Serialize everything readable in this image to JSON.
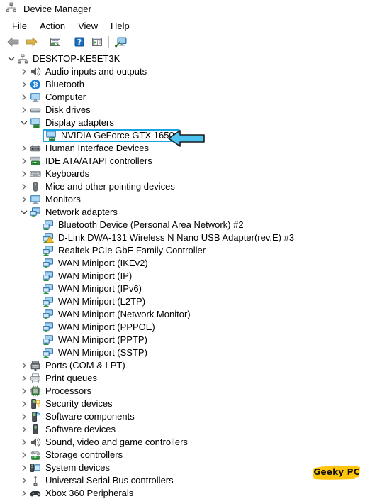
{
  "window": {
    "title": "Device Manager",
    "icon": "device-manager-icon"
  },
  "menubar": {
    "items": [
      {
        "label": "File"
      },
      {
        "label": "Action"
      },
      {
        "label": "View"
      },
      {
        "label": "Help"
      }
    ]
  },
  "toolbar": {
    "buttons": [
      {
        "name": "back-button",
        "icon": "back-arrow-icon"
      },
      {
        "name": "forward-button",
        "icon": "forward-arrow-icon"
      },
      {
        "name": "properties-button",
        "icon": "properties-icon"
      },
      {
        "name": "help-button",
        "icon": "help-question-icon"
      },
      {
        "name": "update-driver-button",
        "icon": "update-driver-icon"
      },
      {
        "name": "scan-hardware-button",
        "icon": "scan-hardware-icon"
      }
    ]
  },
  "annotation": {
    "arrow": {
      "direction": "left",
      "color": "#4cc3ef",
      "outline": "#1a1a1a"
    },
    "highlight_color": "#18a5e0",
    "highlighted_item": "NVIDIA GeForce GTX 1650"
  },
  "watermark": {
    "text": "Geeky PC",
    "bg_color": "#ffc40c"
  },
  "tree": {
    "nodes": [
      {
        "label": "DESKTOP-KE5ET3K",
        "level": 0,
        "state": "expanded",
        "icon": "computer-node-icon",
        "name": "tree-item-desktop-ke5et3k"
      },
      {
        "label": "Audio inputs and outputs",
        "level": 1,
        "state": "collapsed",
        "icon": "speaker-icon",
        "name": "tree-item-audio-inputs-and-outputs"
      },
      {
        "label": "Bluetooth",
        "level": 1,
        "state": "collapsed",
        "icon": "bluetooth-icon",
        "name": "tree-item-bluetooth"
      },
      {
        "label": "Computer",
        "level": 1,
        "state": "collapsed",
        "icon": "monitor-icon",
        "name": "tree-item-computer"
      },
      {
        "label": "Disk drives",
        "level": 1,
        "state": "collapsed",
        "icon": "disk-drive-icon",
        "name": "tree-item-disk-drives"
      },
      {
        "label": "Display adapters",
        "level": 1,
        "state": "expanded",
        "icon": "display-adapter-icon",
        "name": "tree-item-display-adapters"
      },
      {
        "label": "NVIDIA GeForce GTX 1650",
        "level": 2,
        "state": "leaf",
        "icon": "display-adapter-icon",
        "name": "tree-item-nvidia-geforce-gtx-1650",
        "highlighted": true
      },
      {
        "label": "Human Interface Devices",
        "level": 1,
        "state": "collapsed",
        "icon": "hid-icon",
        "name": "tree-item-human-interface-devices"
      },
      {
        "label": "IDE ATA/ATAPI controllers",
        "level": 1,
        "state": "collapsed",
        "icon": "ide-controller-icon",
        "name": "tree-item-ide-ata-atapi-controllers"
      },
      {
        "label": "Keyboards",
        "level": 1,
        "state": "collapsed",
        "icon": "keyboard-icon",
        "name": "tree-item-keyboards"
      },
      {
        "label": "Mice and other pointing devices",
        "level": 1,
        "state": "collapsed",
        "icon": "mouse-icon",
        "name": "tree-item-mice-and-other-pointing-devices"
      },
      {
        "label": "Monitors",
        "level": 1,
        "state": "collapsed",
        "icon": "monitor-icon",
        "name": "tree-item-monitors"
      },
      {
        "label": "Network adapters",
        "level": 1,
        "state": "expanded",
        "icon": "network-adapter-icon",
        "name": "tree-item-network-adapters"
      },
      {
        "label": "Bluetooth Device (Personal Area Network) #2",
        "level": 2,
        "state": "leaf",
        "icon": "network-adapter-icon",
        "name": "tree-item-bluetooth-device-pan-2"
      },
      {
        "label": "D-Link DWA-131 Wireless N Nano USB Adapter(rev.E) #3",
        "level": 2,
        "state": "leaf",
        "icon": "network-adapter-warning-icon",
        "name": "tree-item-d-link-dwa-131",
        "warning": true
      },
      {
        "label": "Realtek PCIe GbE Family Controller",
        "level": 2,
        "state": "leaf",
        "icon": "network-adapter-icon",
        "name": "tree-item-realtek-pcie-gbe-family-controller"
      },
      {
        "label": "WAN Miniport (IKEv2)",
        "level": 2,
        "state": "leaf",
        "icon": "network-adapter-icon",
        "name": "tree-item-wan-miniport-ikev2"
      },
      {
        "label": "WAN Miniport (IP)",
        "level": 2,
        "state": "leaf",
        "icon": "network-adapter-icon",
        "name": "tree-item-wan-miniport-ip"
      },
      {
        "label": "WAN Miniport (IPv6)",
        "level": 2,
        "state": "leaf",
        "icon": "network-adapter-icon",
        "name": "tree-item-wan-miniport-ipv6"
      },
      {
        "label": "WAN Miniport (L2TP)",
        "level": 2,
        "state": "leaf",
        "icon": "network-adapter-icon",
        "name": "tree-item-wan-miniport-l2tp"
      },
      {
        "label": "WAN Miniport (Network Monitor)",
        "level": 2,
        "state": "leaf",
        "icon": "network-adapter-icon",
        "name": "tree-item-wan-miniport-network-monitor"
      },
      {
        "label": "WAN Miniport (PPPOE)",
        "level": 2,
        "state": "leaf",
        "icon": "network-adapter-icon",
        "name": "tree-item-wan-miniport-pppoe"
      },
      {
        "label": "WAN Miniport (PPTP)",
        "level": 2,
        "state": "leaf",
        "icon": "network-adapter-icon",
        "name": "tree-item-wan-miniport-pptp"
      },
      {
        "label": "WAN Miniport (SSTP)",
        "level": 2,
        "state": "leaf",
        "icon": "network-adapter-icon",
        "name": "tree-item-wan-miniport-sstp"
      },
      {
        "label": "Ports (COM & LPT)",
        "level": 1,
        "state": "collapsed",
        "icon": "port-icon",
        "name": "tree-item-ports-com-lpt"
      },
      {
        "label": "Print queues",
        "level": 1,
        "state": "collapsed",
        "icon": "printer-icon",
        "name": "tree-item-print-queues"
      },
      {
        "label": "Processors",
        "level": 1,
        "state": "collapsed",
        "icon": "processor-icon",
        "name": "tree-item-processors"
      },
      {
        "label": "Security devices",
        "level": 1,
        "state": "collapsed",
        "icon": "security-device-icon",
        "name": "tree-item-security-devices"
      },
      {
        "label": "Software components",
        "level": 1,
        "state": "collapsed",
        "icon": "software-component-icon",
        "name": "tree-item-software-components"
      },
      {
        "label": "Software devices",
        "level": 1,
        "state": "collapsed",
        "icon": "software-device-icon",
        "name": "tree-item-software-devices"
      },
      {
        "label": "Sound, video and game controllers",
        "level": 1,
        "state": "collapsed",
        "icon": "speaker-icon",
        "name": "tree-item-sound-video-and-game-controllers"
      },
      {
        "label": "Storage controllers",
        "level": 1,
        "state": "collapsed",
        "icon": "storage-controller-icon",
        "name": "tree-item-storage-controllers"
      },
      {
        "label": "System devices",
        "level": 1,
        "state": "collapsed",
        "icon": "system-device-icon",
        "name": "tree-item-system-devices"
      },
      {
        "label": "Universal Serial Bus controllers",
        "level": 1,
        "state": "collapsed",
        "icon": "usb-icon",
        "name": "tree-item-universal-serial-bus-controllers"
      },
      {
        "label": "Xbox 360 Peripherals",
        "level": 1,
        "state": "collapsed",
        "icon": "gamepad-icon",
        "name": "tree-item-xbox-360-peripherals"
      }
    ]
  }
}
